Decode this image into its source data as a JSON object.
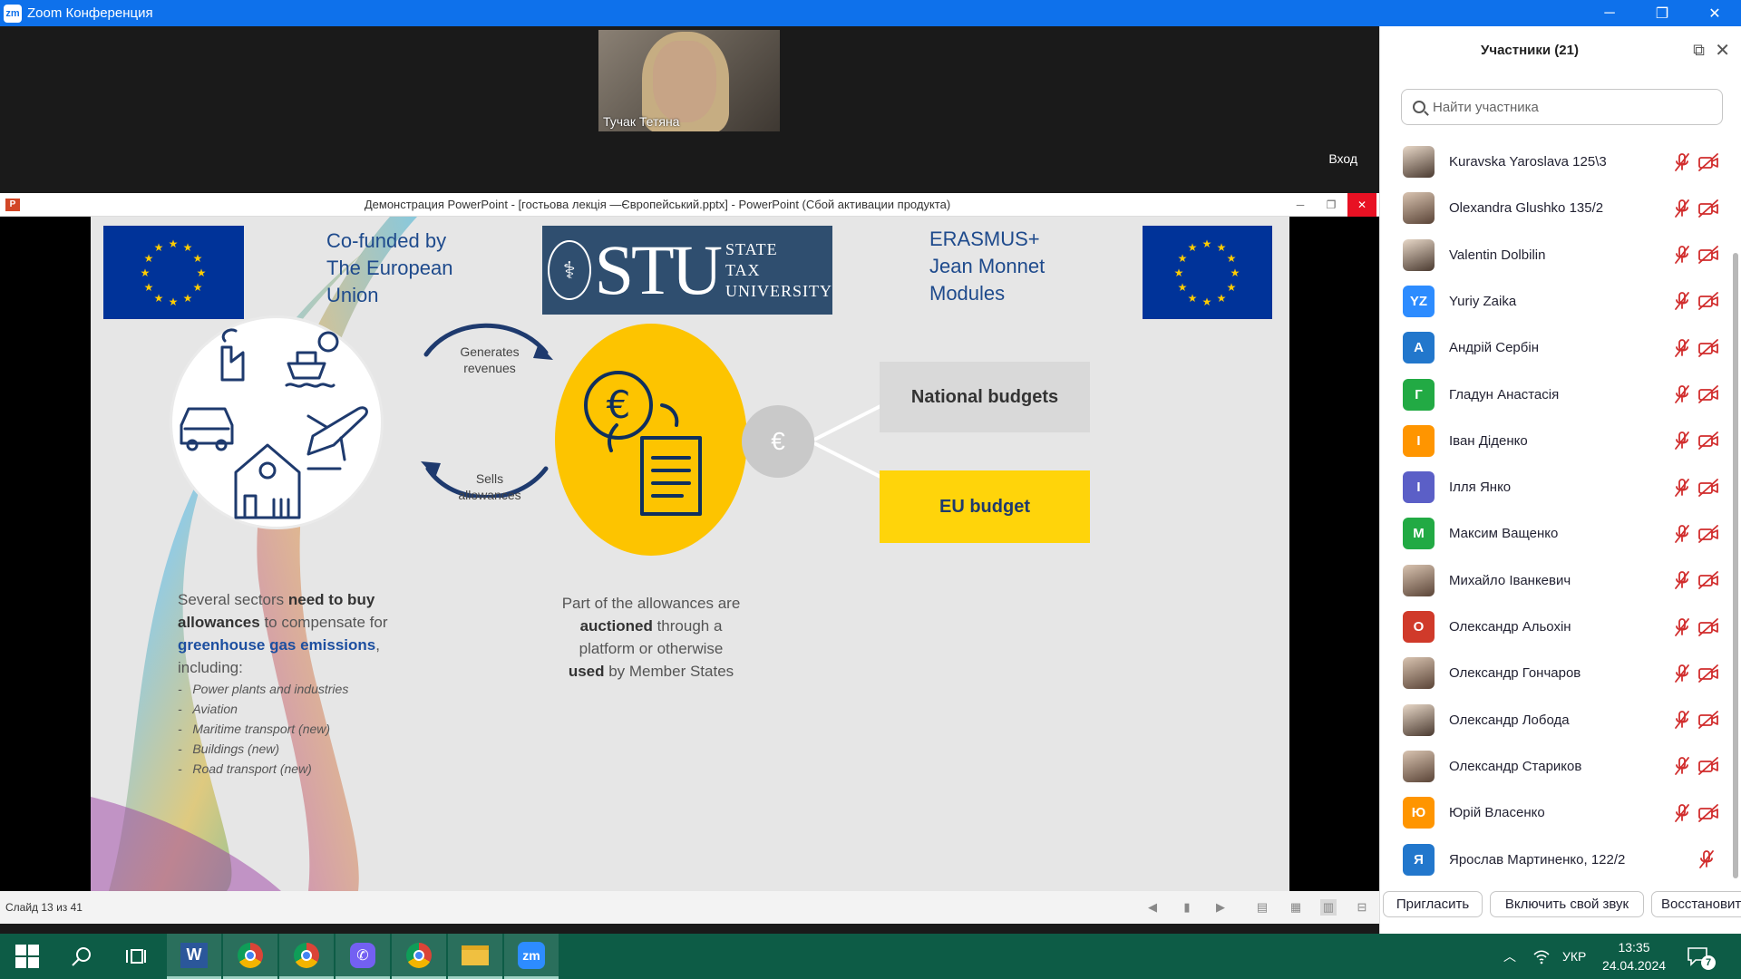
{
  "window": {
    "title": "Zoom Конференция",
    "logo_text": "zm",
    "min": "─",
    "restore": "❐",
    "close": "✕"
  },
  "video": {
    "speaker_name": "Тучак Тетяна",
    "enter_label": "Вход"
  },
  "ppt": {
    "icon_text": "P",
    "doc_title": "Демонстрация PowerPoint - [гостьова лекція —Європейський.pptx] - PowerPoint (Сбой активации продукта)",
    "status_slide": "Слайд 13 из 41"
  },
  "slide": {
    "cofunded": [
      "Co-funded by",
      "The European",
      "Union"
    ],
    "stu_short": "STU",
    "stu_long": [
      "STATE",
      "TAX",
      "UNIVERSITY"
    ],
    "erasmus": [
      "ERASMUS+",
      "Jean Monnet",
      "Modules"
    ],
    "generates": [
      "Generates",
      "revenues"
    ],
    "sells": [
      "Sells",
      "allowances"
    ],
    "national_budgets": "National budgets",
    "eu_budget": "EU budget",
    "sectors_line1_a": "Several sectors ",
    "sectors_line1_b": "need to buy",
    "sectors_line2_a": "allowances",
    "sectors_line2_b": " to compensate for",
    "sectors_line3_a": "greenhouse gas emissions",
    "sectors_line3_b": ",",
    "sectors_line4": "including:",
    "sectors_list": [
      "Power plants and industries",
      "Aviation",
      "Maritime transport (new)",
      "Buildings (new)",
      "Road transport (new)"
    ],
    "auction_l1": "Part of the allowances are",
    "auction_l2a": "auctioned",
    "auction_l2b": " through a",
    "auction_l3": "platform or otherwise",
    "auction_l4a": "used",
    "auction_l4b": " by Member States"
  },
  "panel": {
    "title": "Участники (21)",
    "search_placeholder": "Найти участника",
    "participants": [
      {
        "name": "Kuravska Yaroslava 125\\3",
        "initials": "",
        "color": "",
        "photo": true,
        "cam": true
      },
      {
        "name": "Olexandra Glushko 135/2",
        "initials": "",
        "color": "",
        "photo": true,
        "cam": true
      },
      {
        "name": "Valentin Dolbilin",
        "initials": "",
        "color": "",
        "photo": true,
        "cam": true
      },
      {
        "name": "Yuriy Zaika",
        "initials": "YZ",
        "color": "#2d8cff",
        "photo": false,
        "cam": true
      },
      {
        "name": "Андрій Сербін",
        "initials": "A",
        "color": "#2277cc",
        "photo": false,
        "cam": true
      },
      {
        "name": "Гладун Анастасія",
        "initials": "Г",
        "color": "#22aa44",
        "photo": false,
        "cam": true
      },
      {
        "name": "Іван Діденко",
        "initials": "І",
        "color": "#ff9500",
        "photo": false,
        "cam": true
      },
      {
        "name": "Ілля Янко",
        "initials": "І",
        "color": "#5b5fc7",
        "photo": false,
        "cam": true
      },
      {
        "name": "Максим Ващенко",
        "initials": "М",
        "color": "#22aa44",
        "photo": false,
        "cam": true
      },
      {
        "name": "Михайло Іванкевич",
        "initials": "",
        "color": "",
        "photo": true,
        "cam": true
      },
      {
        "name": "Олександр Альохін",
        "initials": "О",
        "color": "#d03a2a",
        "photo": false,
        "cam": true
      },
      {
        "name": "Олександр Гончаров",
        "initials": "",
        "color": "",
        "photo": true,
        "cam": true
      },
      {
        "name": "Олександр Лобода",
        "initials": "",
        "color": "",
        "photo": true,
        "cam": true
      },
      {
        "name": "Олександр Стариков",
        "initials": "",
        "color": "",
        "photo": true,
        "cam": true
      },
      {
        "name": "Юрій Власенко",
        "initials": "Ю",
        "color": "#ff9500",
        "photo": false,
        "cam": true
      },
      {
        "name": "Ярослав Мартиненко, 122/2",
        "initials": "Я",
        "color": "#2277cc",
        "photo": false,
        "cam": false
      }
    ],
    "invite": "Пригласить",
    "unmute": "Включить свой звук",
    "restore": "Восстановить"
  },
  "taskbar": {
    "lang": "УКР",
    "time": "13:35",
    "date": "24.04.2024",
    "notif_count": "7",
    "zoom_label": "zm"
  },
  "colors": {
    "zoom_blue": "#0e71eb",
    "eu_blue": "#003399",
    "eu_yellow": "#ffcc00",
    "slide_bg": "#e6e6e6",
    "taskbar": "#0d5c46",
    "muted_red": "#d12d2d"
  }
}
